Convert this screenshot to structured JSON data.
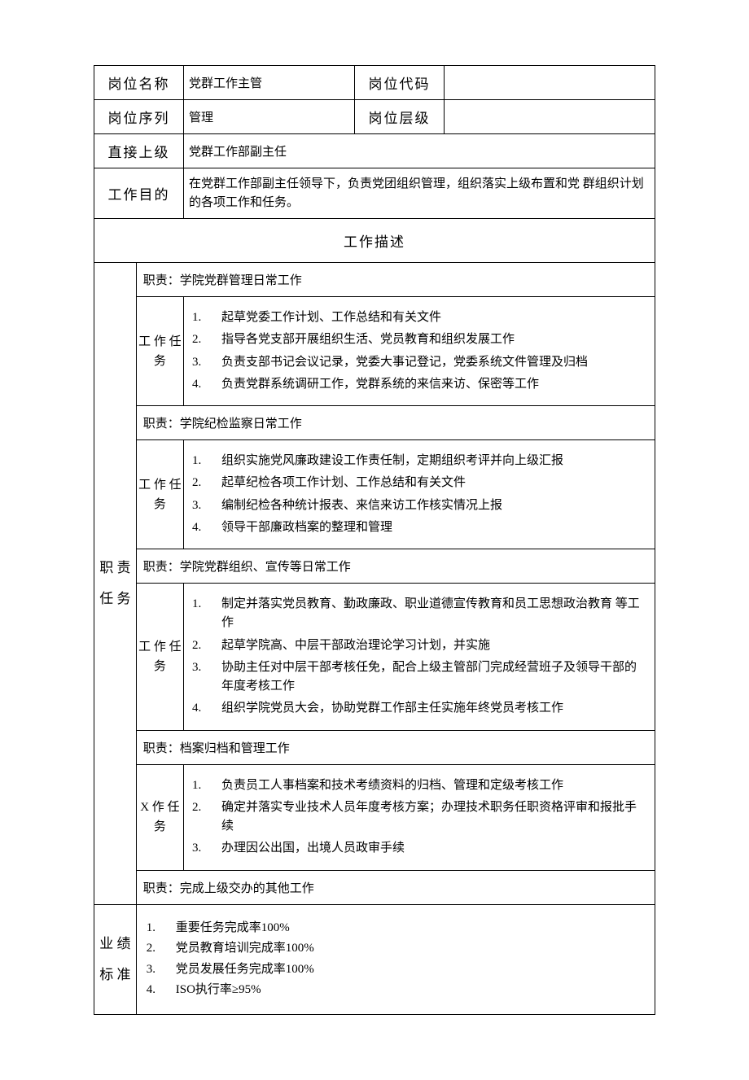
{
  "header": {
    "positionNameLabel": "岗位名称",
    "positionName": "党群工作主管",
    "positionCodeLabel": "岗位代码",
    "positionCode": "",
    "positionSeriesLabel": "岗位序列",
    "positionSeries": "管理",
    "positionLevelLabel": "岗位层级",
    "positionLevel": "",
    "supervisorLabel": "直接上级",
    "supervisor": "党群工作部副主任",
    "purposeLabel": "工作目的",
    "purpose": "在党群工作部副主任领导下，负责党团组织管理，组织落实上级布置和党 群组织计划的各项工作和任务。"
  },
  "sectionDescTitle": "工作描述",
  "dutiesLabel": "职 责 任 务",
  "taskSubLabel": "工 作 任 务",
  "taskSubLabelX": "X 作 任 务",
  "duties": [
    {
      "title": "职责：学院党群管理日常工作",
      "sub": "taskSubLabel",
      "tasks": [
        "起草党委工作计划、工作总结和有关文件",
        "指导各党支部开展组织生活、党员教育和组织发展工作",
        "负责支部书记会议记录，党委大事记登记，党委系统文件管理及归档",
        "负责党群系统调研工作，党群系统的来信来访、保密等工作"
      ]
    },
    {
      "title": "职责：学院纪检监察日常工作",
      "sub": "taskSubLabel",
      "tasks": [
        "组织实施党风廉政建设工作责任制，定期组织考评并向上级汇报",
        "起草纪检各项工作计划、工作总结和有关文件",
        "编制纪检各种统计报表、来信来访工作核实情况上报",
        "领导干部廉政档案的整理和管理"
      ]
    },
    {
      "title": "职责：学院党群组织、宣传等日常工作",
      "sub": "taskSubLabel",
      "tasks": [
        "制定并落实党员教育、勤政廉政、职业道德宣传教育和员工思想政治教育 等工作",
        "起草学院高、中层干部政治理论学习计划，并实施",
        "协助主任对中层干部考核任免，配合上级主管部门完成经营班子及领导干部的年度考核工作",
        "组织学院党员大会，协助党群工作部主任实施年终党员考核工作"
      ]
    },
    {
      "title": "职责：档案归档和管理工作",
      "sub": "taskSubLabelX",
      "tasks": [
        "负责员工人事档案和技术考绩资料的归档、管理和定级考核工作",
        "确定并落实专业技术人员年度考核方案；办理技术职务任职资格评审和报批手续",
        "办理因公出国，出境人员政审手续"
      ]
    },
    {
      "title": "职责：完成上级交办的其他工作",
      "sub": null,
      "tasks": []
    }
  ],
  "standardsLabel": "业 绩 标 准",
  "standards": [
    "重要任务完成率100%",
    "党员教育培训完成率100%",
    "党员发展任务完成率100%",
    "ISO执行率≥95%"
  ]
}
